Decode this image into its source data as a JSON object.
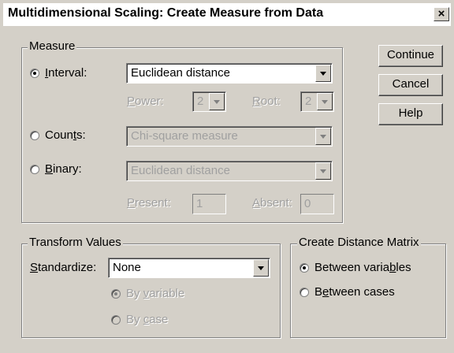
{
  "window": {
    "title": "Multidimensional Scaling: Create Measure from Data",
    "close_glyph": "×"
  },
  "buttons": {
    "continue": "Continue",
    "cancel": "Cancel",
    "help": "Help"
  },
  "measure": {
    "legend": "Measure",
    "interval": {
      "label_pre": "",
      "label_u": "I",
      "label_post": "nterval:",
      "selected": true,
      "value": "Euclidean distance"
    },
    "power": {
      "label_pre": "",
      "label_u": "P",
      "label_post": "ower:",
      "value": "2"
    },
    "root": {
      "label_pre": "",
      "label_u": "R",
      "label_post": "oot:",
      "value": "2"
    },
    "counts": {
      "label_pre": "Coun",
      "label_u": "t",
      "label_post": "s:",
      "selected": false,
      "value": "Chi-square measure"
    },
    "binary": {
      "label_pre": "",
      "label_u": "B",
      "label_post": "inary:",
      "selected": false,
      "value": "Euclidean distance"
    },
    "present": {
      "label_pre": "",
      "label_u": "P",
      "label_post": "resent:",
      "value": "1"
    },
    "absent": {
      "label_pre": "",
      "label_u": "A",
      "label_post": "bsent:",
      "value": "0"
    }
  },
  "transform": {
    "legend": "Transform Values",
    "standardize": {
      "label_pre": "",
      "label_u": "S",
      "label_post": "tandardize:",
      "value": "None"
    },
    "by_variable": {
      "label_pre": "By ",
      "label_u": "v",
      "label_post": "ariable",
      "selected": true
    },
    "by_case": {
      "label_pre": "By ",
      "label_u": "c",
      "label_post": "ase",
      "selected": false
    }
  },
  "distance_matrix": {
    "legend": "Create Distance Matrix",
    "between_variables": {
      "label_pre": "Between varia",
      "label_u": "b",
      "label_post": "les",
      "selected": true
    },
    "between_cases": {
      "label_pre": "B",
      "label_u": "e",
      "label_post": "tween cases",
      "selected": false
    }
  }
}
